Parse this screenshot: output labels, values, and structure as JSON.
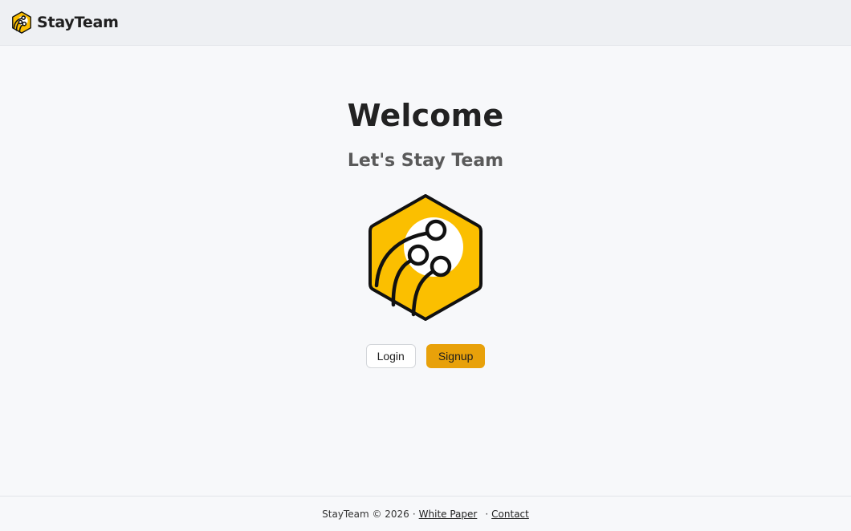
{
  "header": {
    "brand_name": "StayTeam",
    "logo_icon": "stayteam-hexagon-logo-icon"
  },
  "main": {
    "title": "Welcome",
    "subtitle": "Let's Stay Team",
    "hero_icon": "stayteam-hexagon-logo-icon",
    "login_label": "Login",
    "signup_label": "Signup"
  },
  "footer": {
    "copyright": "StayTeam © 2026",
    "separator": "·",
    "white_paper_label": "White Paper",
    "contact_label": "Contact"
  },
  "colors": {
    "brand_yellow": "#fbbf00",
    "signup_button": "#e8a10a",
    "page_background": "#f7f8fa",
    "header_background": "#eef0f3"
  }
}
